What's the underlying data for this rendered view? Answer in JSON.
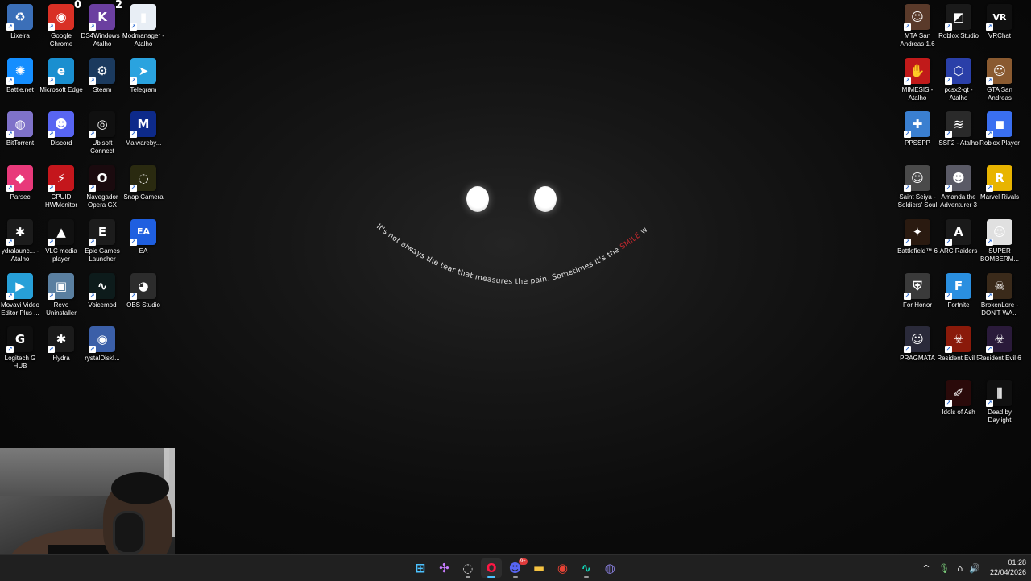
{
  "desktop": {
    "wallpaper": {
      "caption_parts": [
        "It's not always the tear that measures the pain. Sometimes it's the ",
        "SMILE",
        " we fake"
      ],
      "highlight_color": "#c0282e"
    },
    "left_icons": [
      {
        "label": "Lixeira",
        "icon": "recycle-bin-icon",
        "color": "#3b6fb8",
        "glyph": "♻",
        "badge": ""
      },
      {
        "label": "Google Chrome",
        "icon": "chrome-icon",
        "color": "#d93025",
        "glyph": "◉",
        "badge": "0"
      },
      {
        "label": "DS4Windows - Atalho",
        "icon": "ds4windows-icon",
        "color": "#6b3fa0",
        "glyph": "K",
        "badge": "2"
      },
      {
        "label": "Modmanager - Atalho",
        "icon": "modmanager-icon",
        "color": "#e8eef5",
        "glyph": "▮",
        "badge": ""
      },
      {
        "label": "Battle.net",
        "icon": "battlenet-icon",
        "color": "#148eff",
        "glyph": "✺",
        "badge": ""
      },
      {
        "label": "Microsoft Edge",
        "icon": "edge-icon",
        "color": "#1a8fd0",
        "glyph": "e",
        "badge": ""
      },
      {
        "label": "Steam",
        "icon": "steam-icon",
        "color": "#1b3a5e",
        "glyph": "⚙",
        "badge": ""
      },
      {
        "label": "Telegram",
        "icon": "telegram-icon",
        "color": "#2aa3df",
        "glyph": "➤",
        "badge": ""
      },
      {
        "label": "BitTorrent",
        "icon": "bittorrent-icon",
        "color": "#7f72c9",
        "glyph": "◍",
        "badge": ""
      },
      {
        "label": "Discord",
        "icon": "discord-icon",
        "color": "#5865f2",
        "glyph": "☻",
        "badge": ""
      },
      {
        "label": "Ubisoft Connect",
        "icon": "ubisoft-icon",
        "color": "#101010",
        "glyph": "◎",
        "badge": ""
      },
      {
        "label": "Malwareby...",
        "icon": "malwarebytes-icon",
        "color": "#0d2a8a",
        "glyph": "M",
        "badge": ""
      },
      {
        "label": "Parsec",
        "icon": "parsec-icon",
        "color": "#e8397a",
        "glyph": "◆",
        "badge": ""
      },
      {
        "label": "CPUID HWMonitor",
        "icon": "hwmonitor-icon",
        "color": "#c4161c",
        "glyph": "⚡",
        "badge": ""
      },
      {
        "label": "Navegador Opera GX",
        "icon": "opera-gx-icon",
        "color": "#1a0a0e",
        "glyph": "O",
        "badge": ""
      },
      {
        "label": "Snap Camera",
        "icon": "snap-camera-icon",
        "color": "#2a2a10",
        "glyph": "◌",
        "badge": ""
      },
      {
        "label": "ydralaunc... - Atalho",
        "icon": "hydra-launcher-icon",
        "color": "#1b1b1b",
        "glyph": "✱",
        "badge": ""
      },
      {
        "label": "VLC media player",
        "icon": "vlc-icon",
        "color": "#111111",
        "glyph": "▲",
        "badge": ""
      },
      {
        "label": "Epic Games Launcher",
        "icon": "epic-games-icon",
        "color": "#1c1c1c",
        "glyph": "E",
        "badge": ""
      },
      {
        "label": "EA",
        "icon": "ea-icon",
        "color": "#1f5fe0",
        "glyph": "EA",
        "badge": ""
      },
      {
        "label": "Movavi Video Editor Plus ...",
        "icon": "movavi-icon",
        "color": "#27a0d8",
        "glyph": "▶",
        "badge": ""
      },
      {
        "label": "Revo Uninstaller",
        "icon": "revo-icon",
        "color": "#5a7fa0",
        "glyph": "▣",
        "badge": ""
      },
      {
        "label": "Voicemod",
        "icon": "voicemod-icon",
        "color": "#0d1b1b",
        "glyph": "∿",
        "badge": ""
      },
      {
        "label": "OBS Studio",
        "icon": "obs-icon",
        "color": "#2c2c2c",
        "glyph": "◕",
        "badge": ""
      },
      {
        "label": "Logitech G HUB",
        "icon": "logitech-icon",
        "color": "#0f0f0f",
        "glyph": "G",
        "badge": ""
      },
      {
        "label": "Hydra",
        "icon": "hydra-icon",
        "color": "#1b1b1b",
        "glyph": "✱",
        "badge": ""
      },
      {
        "label": "rystalDiskI...",
        "icon": "crystaldisk-icon",
        "color": "#3b5fa8",
        "glyph": "◉",
        "badge": ""
      }
    ],
    "right_icons": [
      {
        "label": "MTA San Andreas 1.6",
        "icon": "mta-icon",
        "color": "#5a3a2a",
        "glyph": "☺",
        "badge": ""
      },
      {
        "label": "Roblox Studio",
        "icon": "roblox-studio-icon",
        "color": "#1a1a1a",
        "glyph": "◩",
        "badge": ""
      },
      {
        "label": "VRChat",
        "icon": "vrchat-icon",
        "color": "#101010",
        "glyph": "VR",
        "badge": ""
      },
      {
        "label": "MIMESIS - Atalho",
        "icon": "mimesis-icon",
        "color": "#c11a1a",
        "glyph": "✋",
        "badge": ""
      },
      {
        "label": "pcsx2-qt - Atalho",
        "icon": "pcsx2-icon",
        "color": "#2a3fa8",
        "glyph": "⬡",
        "badge": ""
      },
      {
        "label": "GTA San Andreas",
        "icon": "gta-sa-icon",
        "color": "#8a5a30",
        "glyph": "☺",
        "badge": ""
      },
      {
        "label": "PPSSPP",
        "icon": "ppsspp-icon",
        "color": "#3a7fd0",
        "glyph": "✚",
        "badge": ""
      },
      {
        "label": "SSF2 - Atalho",
        "icon": "ssf2-icon",
        "color": "#2a2a2a",
        "glyph": "≋",
        "badge": ""
      },
      {
        "label": "Roblox Player",
        "icon": "roblox-player-icon",
        "color": "#3a6ff0",
        "glyph": "◼",
        "badge": ""
      },
      {
        "label": "Saint Seiya - Soldiers' Soul",
        "icon": "saint-seiya-icon",
        "color": "#4a4a4a",
        "glyph": "☺",
        "badge": ""
      },
      {
        "label": "Amanda the Adventurer 3",
        "icon": "amanda-icon",
        "color": "#5a5a66",
        "glyph": "☻",
        "badge": ""
      },
      {
        "label": "Marvel Rivals",
        "icon": "marvel-rivals-icon",
        "color": "#e8b400",
        "glyph": "R",
        "badge": ""
      },
      {
        "label": "Battlefield™ 6",
        "icon": "battlefield-icon",
        "color": "#2a1a10",
        "glyph": "✦",
        "badge": ""
      },
      {
        "label": "ARC Raiders",
        "icon": "arc-raiders-icon",
        "color": "#1a1a1a",
        "glyph": "A",
        "badge": ""
      },
      {
        "label": "SUPER BOMBERM...",
        "icon": "bomberman-icon",
        "color": "#e0e0e0",
        "glyph": "☺",
        "badge": ""
      },
      {
        "label": "For Honor",
        "icon": "for-honor-icon",
        "color": "#3a3a3a",
        "glyph": "⛨",
        "badge": ""
      },
      {
        "label": "Fortnite",
        "icon": "fortnite-icon",
        "color": "#2a8fe0",
        "glyph": "F",
        "badge": ""
      },
      {
        "label": "BrokenLore - DON'T WA...",
        "icon": "brokenlore-icon",
        "color": "#3a2a1a",
        "glyph": "☠",
        "badge": ""
      },
      {
        "label": "PRAGMATA",
        "icon": "pragmata-icon",
        "color": "#2a2a3a",
        "glyph": "☺",
        "badge": ""
      },
      {
        "label": "Resident Evil 5",
        "icon": "re5-icon",
        "color": "#8a1a0a",
        "glyph": "☣",
        "badge": ""
      },
      {
        "label": "Resident Evil 6",
        "icon": "re6-icon",
        "color": "#2a1a3a",
        "glyph": "☣",
        "badge": ""
      },
      {
        "label": "Idols of Ash",
        "icon": "idols-of-ash-icon",
        "color": "#2a0a0a",
        "glyph": "✐",
        "badge": ""
      },
      {
        "label": "Dead by Daylight",
        "icon": "dbd-icon",
        "color": "#101010",
        "glyph": "⫼",
        "badge": ""
      }
    ]
  },
  "taskbar": {
    "apps": [
      {
        "name": "start-button",
        "icon": "windows-start-icon",
        "color": "#4cc2ff",
        "glyph": "⊞",
        "active": false,
        "open": false
      },
      {
        "name": "copilot-button",
        "icon": "copilot-icon",
        "color": "#c77dff",
        "glyph": "✣",
        "active": false,
        "open": false
      },
      {
        "name": "hydra-taskbar-button",
        "icon": "hydra-icon",
        "color": "#d0d0d0",
        "glyph": "◌",
        "active": false,
        "open": true
      },
      {
        "name": "opera-gx-taskbar-button",
        "icon": "opera-gx-icon",
        "color": "#ff1744",
        "glyph": "O",
        "active": true,
        "open": true
      },
      {
        "name": "discord-taskbar-button",
        "icon": "discord-icon",
        "color": "#5865f2",
        "glyph": "☻",
        "active": false,
        "open": true
      },
      {
        "name": "file-explorer-button",
        "icon": "folder-icon",
        "color": "#f5c342",
        "glyph": "▬",
        "active": false,
        "open": false
      },
      {
        "name": "chrome-taskbar-button",
        "icon": "chrome-icon",
        "color": "#ea4335",
        "glyph": "◉",
        "active": false,
        "open": false
      },
      {
        "name": "voicemod-taskbar-button",
        "icon": "voicemod-icon",
        "color": "#12d6b8",
        "glyph": "∿",
        "active": false,
        "open": true
      },
      {
        "name": "bittorrent-taskbar-button",
        "icon": "bittorrent-icon",
        "color": "#8a80e0",
        "glyph": "◍",
        "active": false,
        "open": false
      }
    ],
    "discord_badge": "9+",
    "tray": {
      "chevron_glyph": "^",
      "icons": [
        {
          "icon": "microphone-icon",
          "glyph": "🎙"
        },
        {
          "icon": "network-icon",
          "glyph": "⌂"
        },
        {
          "icon": "volume-icon",
          "glyph": "🔊"
        }
      ],
      "time": "01:28",
      "date": "22/04/2026"
    }
  },
  "webcam": {
    "icon": "webcam-overlay"
  }
}
